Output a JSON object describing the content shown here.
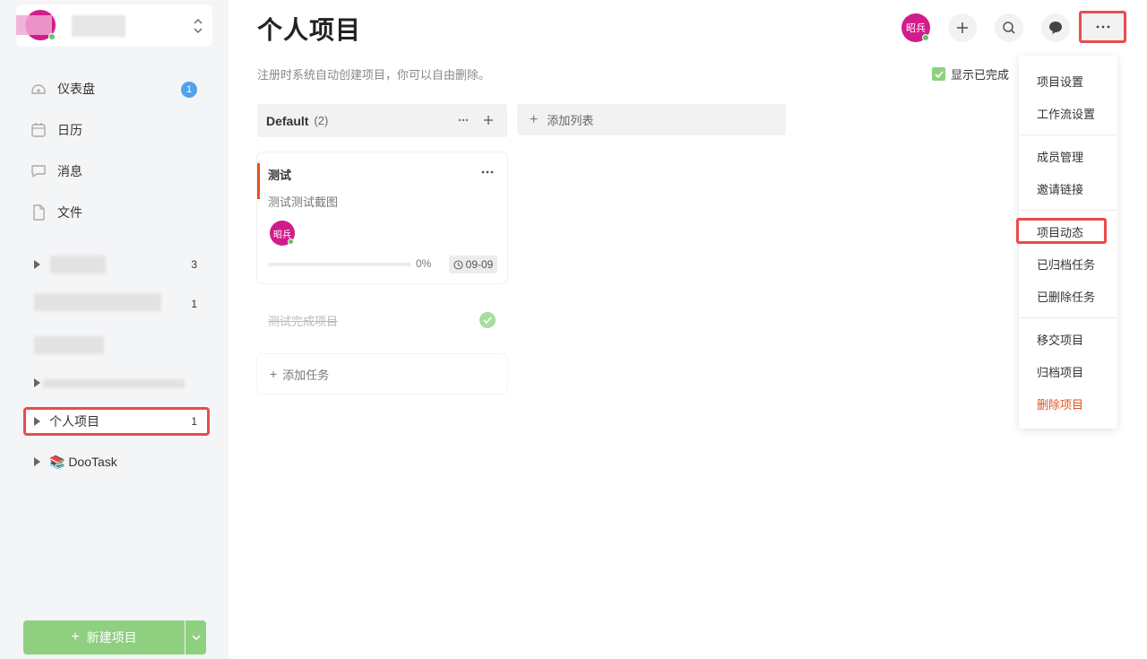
{
  "sidebar": {
    "user_card": {
      "switch_icon": "chevron-up-down-icon"
    },
    "menu": [
      {
        "label": "仪表盘",
        "icon": "dashboard-icon",
        "badge": "1"
      },
      {
        "label": "日历",
        "icon": "calendar-icon"
      },
      {
        "label": "消息",
        "icon": "message-icon"
      },
      {
        "label": "文件",
        "icon": "file-icon"
      }
    ],
    "projects": [
      {
        "label": "",
        "count": "3",
        "redacted": true
      },
      {
        "label": "",
        "count": "1",
        "redacted": true
      },
      {
        "label": "",
        "count": "",
        "redacted": true
      },
      {
        "label": "",
        "count": "",
        "redacted": true
      },
      {
        "label": "个人项目",
        "count": "1",
        "active": true
      },
      {
        "label": "📚 DooTask",
        "count": ""
      }
    ],
    "new_project_label": "新建项目"
  },
  "header": {
    "title": "个人项目",
    "description": "注册时系统自动创建项目，你可以自由删除。",
    "avatar_text": "昭兵",
    "show_completed_label": "显示已完成"
  },
  "board": {
    "column": {
      "name": "Default",
      "count": "(2)"
    },
    "add_column_label": "添加列表",
    "task": {
      "title": "测试",
      "description": "测试测试截图",
      "assignee": "昭兵",
      "progress": "0%",
      "progress_value": 0,
      "due": "09-09"
    },
    "completed_task": {
      "title": "测试完成项目"
    },
    "add_task_label": "添加任务"
  },
  "dropdown": {
    "groups": [
      [
        "项目设置",
        "工作流设置"
      ],
      [
        "成员管理",
        "邀请链接"
      ],
      [
        "项目动态",
        "已归档任务",
        "已删除任务"
      ],
      [
        "移交项目",
        "归档项目",
        "删除项目"
      ]
    ]
  },
  "colors": {
    "accent_green": "#8ed07f",
    "avatar_magenta": "#d11c8c",
    "highlight_red": "#e84c4c",
    "danger": "#e8501f",
    "badge_blue": "#4fa3ec"
  }
}
